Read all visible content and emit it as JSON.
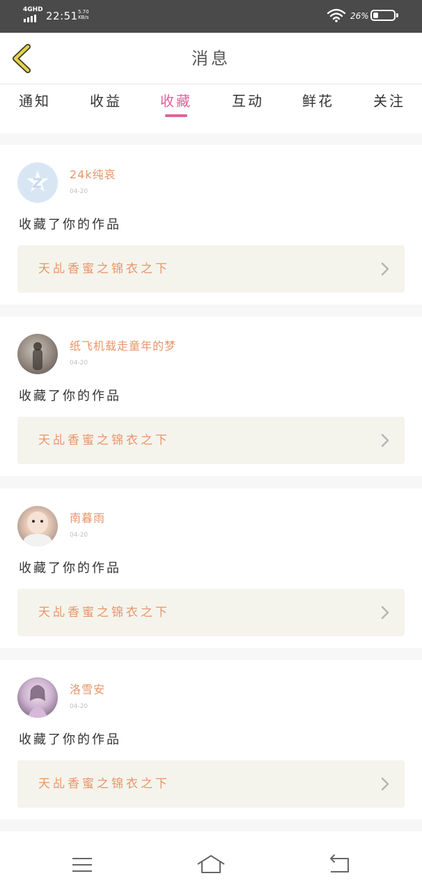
{
  "status_bar": {
    "network": "4GHD",
    "time": "22:51",
    "speed_value": "5.70",
    "speed_unit": "KB/s",
    "battery_text": "26%",
    "battery_level": 0.26
  },
  "header": {
    "title": "消息"
  },
  "tabs": [
    {
      "label": "通知"
    },
    {
      "label": "收益"
    },
    {
      "label": "收藏"
    },
    {
      "label": "互动"
    },
    {
      "label": "鲜花"
    },
    {
      "label": "关注"
    }
  ],
  "active_tab": "收藏",
  "messages": [
    {
      "user": "24k纯哀",
      "time": "04-20",
      "action": "收藏了你的作品",
      "work_title": "天乩香蜜之锦衣之下"
    },
    {
      "user": "纸飞机载走童年的梦",
      "time": "04-20",
      "action": "收藏了你的作品",
      "work_title": "天乩香蜜之锦衣之下"
    },
    {
      "user": "南暮雨",
      "time": "04-20",
      "action": "收藏了你的作品",
      "work_title": "天乩香蜜之锦衣之下"
    },
    {
      "user": "洛雪安",
      "time": "04-20",
      "action": "收藏了你的作品",
      "work_title": "天乩香蜜之锦衣之下"
    }
  ],
  "colors": {
    "accent": "#e0619a",
    "username": "#e8956a",
    "work_bg": "#f4f4ec",
    "status_bar": "#4a4a4a",
    "back_arrow": "#e3d24a"
  },
  "icons": {
    "back": "chevron-left-icon",
    "row_arrow": "chevron-right-icon",
    "nav": [
      "menu-icon",
      "home-icon",
      "return-icon"
    ]
  }
}
